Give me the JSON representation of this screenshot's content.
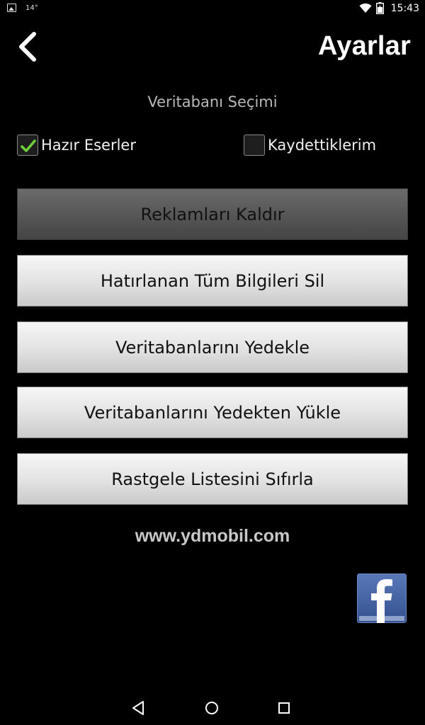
{
  "status_bar": {
    "temperature": "14°",
    "time": "15:43"
  },
  "header": {
    "title": "Ayarlar"
  },
  "database": {
    "label": "Veritabanı Seçimi",
    "options": [
      {
        "label": "Hazır Eserler",
        "checked": true
      },
      {
        "label": "Kaydettiklerim",
        "checked": false
      }
    ]
  },
  "buttons": {
    "remove_ads": "Reklamları Kaldır",
    "clear_remembered": "Hatırlanan Tüm Bilgileri Sil",
    "backup_db": "Veritabanlarını Yedekle",
    "restore_db": "Veritabanlarını Yedekten Yükle",
    "reset_random": "Rastgele Listesini Sıfırla"
  },
  "website": "www.ydmobil.com",
  "colors": {
    "checkmark": "#6fd13a",
    "facebook_blue": "#3b5998"
  }
}
